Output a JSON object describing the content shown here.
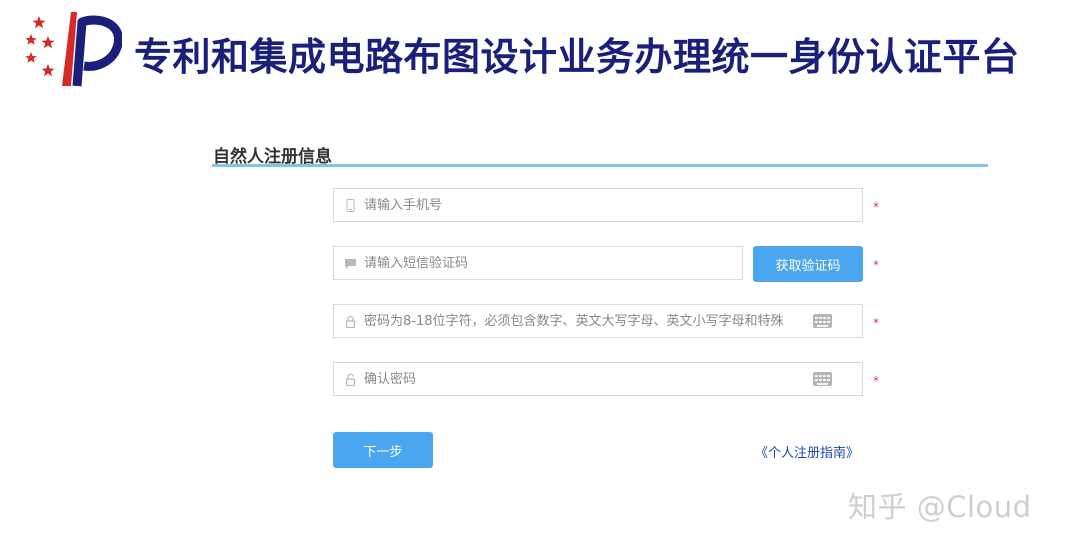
{
  "header": {
    "title": "专利和集成电路布图设计业务办理统一身份认证平台",
    "logo_icon": "cnipa-logo-icon"
  },
  "section": {
    "title": "自然人注册信息"
  },
  "form": {
    "phone": {
      "placeholder": "请输入手机号",
      "icon": "phone-icon"
    },
    "sms_code": {
      "placeholder": "请输入短信验证码",
      "icon": "message-icon"
    },
    "get_code_button": "获取验证码",
    "password": {
      "placeholder": "密码为8-18位字符，必须包含数字、英文大写字母、英文小写字母和特殊",
      "icon": "lock-icon"
    },
    "confirm_password": {
      "placeholder": "确认密码",
      "icon": "unlock-icon"
    },
    "required_mark": "*",
    "next_button": "下一步",
    "guide_link": "《个人注册指南》"
  },
  "watermark": "知乎 @Cloud",
  "colors": {
    "title": "#1a1f7a",
    "accent": "#4aa6ee",
    "rule": "#7fc6e6",
    "required": "#e03a3a",
    "link": "#1e49a8"
  }
}
